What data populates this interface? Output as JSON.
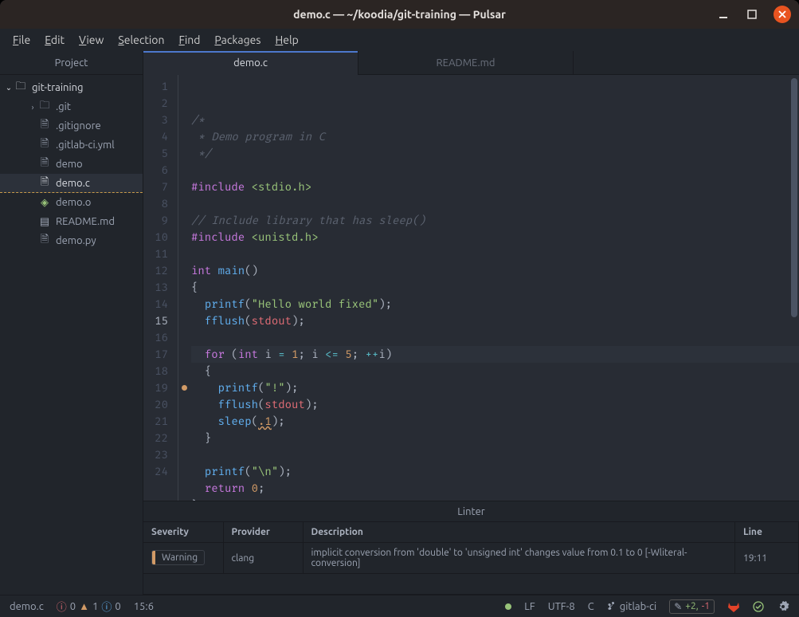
{
  "window": {
    "title": "demo.c — ~/koodia/git-training — Pulsar"
  },
  "menubar": [
    "File",
    "Edit",
    "View",
    "Selection",
    "Find",
    "Packages",
    "Help"
  ],
  "sidebar": {
    "title": "Project",
    "root": {
      "label": "git-training",
      "icon": "repo"
    },
    "items": [
      {
        "label": ".git",
        "icon": "folder",
        "depth": 1,
        "chev": "›"
      },
      {
        "label": ".gitignore",
        "icon": "file",
        "depth": 1
      },
      {
        "label": ".gitlab-ci.yml",
        "icon": "file",
        "depth": 1
      },
      {
        "label": "demo",
        "icon": "file",
        "depth": 1
      },
      {
        "label": "demo.c",
        "icon": "file",
        "depth": 1,
        "selected": true
      },
      {
        "label": "demo.o",
        "icon": "obj",
        "depth": 1,
        "tint": "#98c379"
      },
      {
        "label": "README.md",
        "icon": "md",
        "depth": 1
      },
      {
        "label": "demo.py",
        "icon": "file",
        "depth": 1
      }
    ]
  },
  "tabs": [
    {
      "label": "demo.c",
      "active": true
    },
    {
      "label": "README.md",
      "active": false
    }
  ],
  "code_lines": [
    "/*",
    " * Demo program in C",
    " */",
    "",
    "#include <stdio.h>",
    "",
    "// Include library that has sleep()",
    "#include <unistd.h>",
    "",
    "int main()",
    "{",
    "  printf(\"Hello world fixed\");",
    "  fflush(stdout);",
    "",
    "  for (int i = 1; i <= 5; ++i)",
    "  {",
    "    printf(\"!\");",
    "    fflush(stdout);",
    "    sleep(.1);",
    "  }",
    "",
    "  printf(\"\\n\");",
    "  return 0;",
    "}"
  ],
  "highlighted_line": 15,
  "warning_line": 19,
  "linter": {
    "title": "Linter",
    "headers": [
      "Severity",
      "Provider",
      "Description",
      "Line"
    ],
    "row": {
      "severity": "Warning",
      "provider": "clang",
      "description": "implicit conversion from 'double' to 'unsigned int' changes value from 0.1 to 0 [-Wliteral-conversion]",
      "line": "19:11"
    }
  },
  "statusbar": {
    "file": "demo.c",
    "errors": "0",
    "warnings": "1",
    "info": "0",
    "cursor": "15:6",
    "eol": "LF",
    "encoding": "UTF-8",
    "lang": "C",
    "branch": "gitlab-ci",
    "changes_plus": "+2,",
    "changes_minus": "-1"
  }
}
